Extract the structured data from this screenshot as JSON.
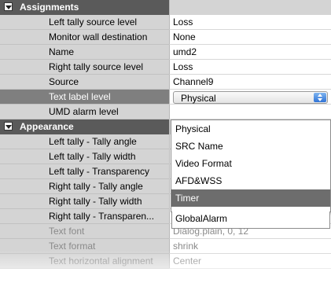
{
  "categories": {
    "assignments": "Assignments",
    "appearance": "Appearance"
  },
  "rows": {
    "r1": {
      "label": "Left tally source level",
      "value": "Loss"
    },
    "r2": {
      "label": "Monitor wall destination",
      "value": "None"
    },
    "r3": {
      "label": "Name",
      "value": "umd2"
    },
    "r4": {
      "label": "Right tally source level",
      "value": "Loss"
    },
    "r5": {
      "label": "Source",
      "value": "Channel9"
    },
    "r6": {
      "label": "Text label level",
      "value": "Physical"
    },
    "r7": {
      "label": "UMD alarm level",
      "value": ""
    },
    "a1": {
      "label": "Left tally - Tally angle",
      "value": ""
    },
    "a2": {
      "label": "Left tally - Tally width",
      "value": ""
    },
    "a3": {
      "label": "Left tally - Transparency",
      "value": ""
    },
    "a4": {
      "label": "Right tally - Tally angle",
      "value": ""
    },
    "a5": {
      "label": "Right tally - Tally width",
      "value": ""
    },
    "a6": {
      "label": "Right tally - Transparen...",
      "value": ""
    },
    "a7": {
      "label": "Text font",
      "value": "Dialog.plain, 0, 12"
    },
    "a8": {
      "label": "Text format",
      "value": "shrink"
    },
    "a9": {
      "label": "Text horizontal alignment",
      "value": "Center"
    }
  },
  "dropdown": {
    "options": [
      "Physical",
      "SRC Name",
      "Video Format",
      "AFD&WSS",
      "Timer",
      "GlobalAlarm"
    ],
    "highlighted": "Timer"
  }
}
